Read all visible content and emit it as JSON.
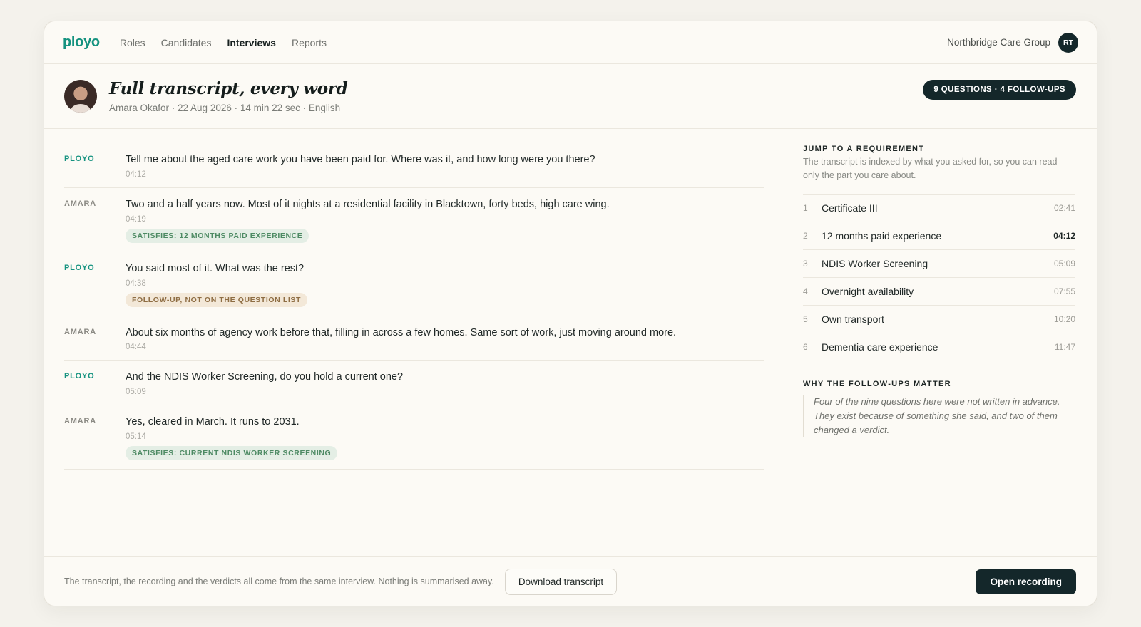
{
  "nav": {
    "logo": "ployo",
    "items": [
      {
        "label": "Roles",
        "active": false
      },
      {
        "label": "Candidates",
        "active": false
      },
      {
        "label": "Interviews",
        "active": true
      },
      {
        "label": "Reports",
        "active": false
      }
    ],
    "org": "Northbridge Care Group",
    "user_initials": "RT"
  },
  "header": {
    "title": "Full transcript, every word",
    "meta": "Amara Okafor · 22 Aug 2026 · 14 min 22 sec · English",
    "count_pill": "9 QUESTIONS · 4 FOLLOW-UPS"
  },
  "transcript": [
    {
      "speaker": "PLOYO",
      "text": "Tell me about the aged care work you have been paid for. Where was it, and how long were you there?",
      "time": "04:12",
      "tag": null
    },
    {
      "speaker": "AMARA",
      "text": "Two and a half years now. Most of it nights at a residential facility in Blacktown, forty beds, high care wing.",
      "time": "04:19",
      "tag": {
        "kind": "satisfies",
        "label": "SATISFIES: 12 MONTHS PAID EXPERIENCE"
      }
    },
    {
      "speaker": "PLOYO",
      "text": "You said most of it. What was the rest?",
      "time": "04:38",
      "tag": {
        "kind": "followup",
        "label": "FOLLOW-UP, NOT ON THE QUESTION LIST"
      }
    },
    {
      "speaker": "AMARA",
      "text": "About six months of agency work before that, filling in across a few homes. Same sort of work, just moving around more.",
      "time": "04:44",
      "tag": null
    },
    {
      "speaker": "PLOYO",
      "text": "And the NDIS Worker Screening, do you hold a current one?",
      "time": "05:09",
      "tag": null
    },
    {
      "speaker": "AMARA",
      "text": "Yes, cleared in March. It runs to 2031.",
      "time": "05:14",
      "tag": {
        "kind": "satisfies",
        "label": "SATISFIES: CURRENT NDIS WORKER SCREENING"
      }
    }
  ],
  "sidebar": {
    "jump_heading": "JUMP TO A REQUIREMENT",
    "jump_desc": "The transcript is indexed by what you asked for, so you can read only the part you care about.",
    "requirements": [
      {
        "num": "1",
        "label": "Certificate III",
        "time": "02:41",
        "active": false
      },
      {
        "num": "2",
        "label": "12 months paid experience",
        "time": "04:12",
        "active": true
      },
      {
        "num": "3",
        "label": "NDIS Worker Screening",
        "time": "05:09",
        "active": false
      },
      {
        "num": "4",
        "label": "Overnight availability",
        "time": "07:55",
        "active": false
      },
      {
        "num": "5",
        "label": "Own transport",
        "time": "10:20",
        "active": false
      },
      {
        "num": "6",
        "label": "Dementia care experience",
        "time": "11:47",
        "active": false
      }
    ],
    "why_heading": "WHY THE FOLLOW-UPS MATTER",
    "why_text": "Four of the nine questions here were not written in advance. They exist because of something she said, and two of them changed a verdict."
  },
  "footer": {
    "note": "The transcript, the recording and the verdicts all come from the same interview. Nothing is summarised away.",
    "download_label": "Download transcript",
    "open_label": "Open recording"
  },
  "colors": {
    "brand": "#14927f",
    "dark": "#14272a",
    "satisfies_bg": "#e4eee5",
    "followup_bg": "#f3e8d8"
  }
}
